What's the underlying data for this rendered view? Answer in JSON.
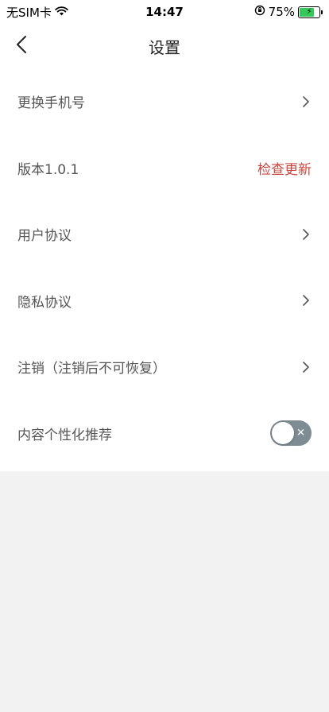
{
  "status_bar": {
    "carrier": "无SIM卡",
    "time": "14:47",
    "battery_percent": "75%",
    "battery_level": 0.75,
    "battery_color": "#34c759"
  },
  "nav": {
    "title": "设置",
    "back_icon": "chevron-left-icon"
  },
  "settings": {
    "items": [
      {
        "label": "更换手机号",
        "type": "link",
        "icon": "chevron-right-icon"
      },
      {
        "label": "版本1.0.1",
        "type": "action",
        "action_label": "检查更新",
        "action_color": "#c9463d"
      },
      {
        "label": "用户协议",
        "type": "link",
        "icon": "chevron-right-icon"
      },
      {
        "label": "隐私协议",
        "type": "link",
        "icon": "chevron-right-icon"
      },
      {
        "label": "注销（注销后不可恢复）",
        "type": "link",
        "icon": "chevron-right-icon"
      },
      {
        "label": "内容个性化推荐",
        "type": "toggle",
        "toggle_state": "off",
        "toggle_color": "#7e8c93"
      }
    ]
  },
  "colors": {
    "background": "#f2f2f2",
    "card": "#ffffff",
    "text": "#555555"
  }
}
